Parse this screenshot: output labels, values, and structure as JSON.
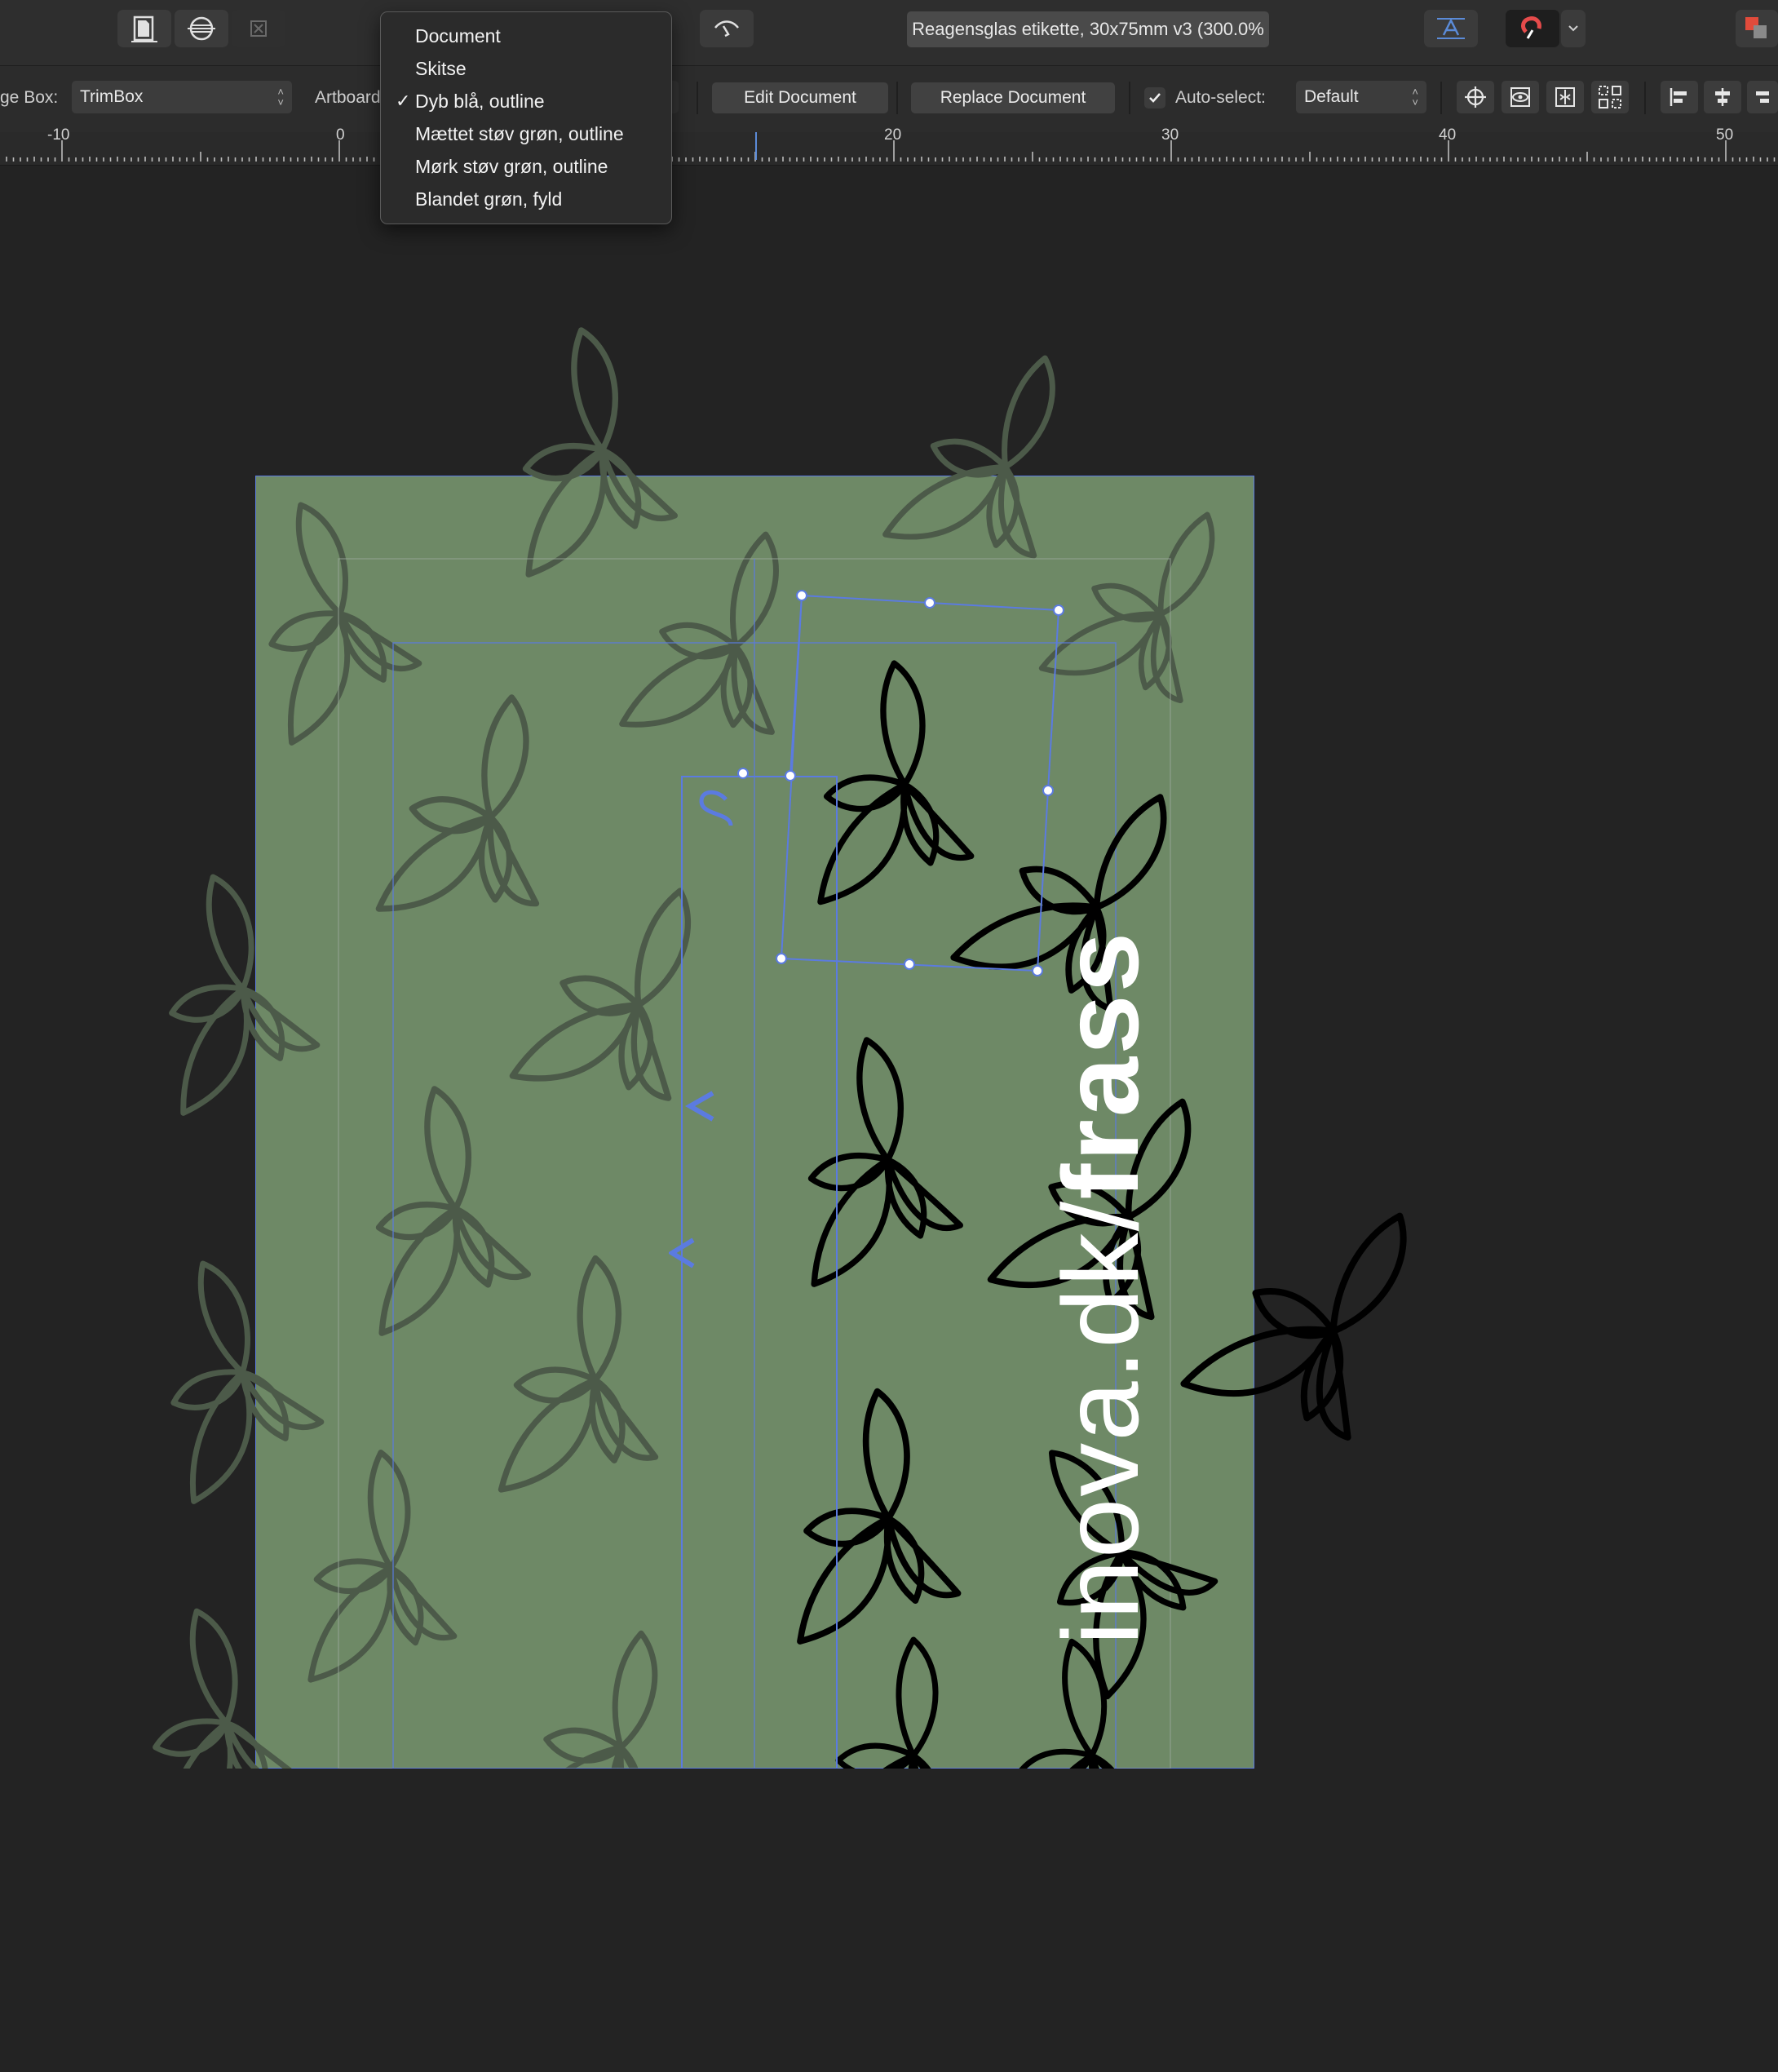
{
  "toolbar": {
    "document_title": "Reagensglas etikette, 30x75mm v3 (300.0%"
  },
  "context_bar": {
    "page_box_label": "ge Box:",
    "page_box_value": "TrimBox",
    "artboard_label": "Artboard",
    "edit_document": "Edit Document",
    "replace_document": "Replace Document",
    "auto_select_label": "Auto-select:",
    "auto_select_checked": true,
    "auto_select_value": "Default"
  },
  "artboard_menu": {
    "items": [
      {
        "label": "Document",
        "checked": false
      },
      {
        "label": "Skitse",
        "checked": false
      },
      {
        "label": "Dyb blå, outline",
        "checked": true
      },
      {
        "label": "Mættet støv grøn, outline",
        "checked": false
      },
      {
        "label": "Mørk støv grøn, outline",
        "checked": false
      },
      {
        "label": "Blandet grøn, fyld",
        "checked": false
      }
    ]
  },
  "ruler": {
    "labels": [
      "-10",
      "0",
      "20",
      "30",
      "40",
      "50"
    ]
  },
  "canvas": {
    "label_text_plain": "inova.dk/",
    "label_text_bold": "frass",
    "artboard_color": "#6e8966",
    "selection_color": "#5b7be0",
    "leaf_fill_faint": "#4c5a49",
    "leaf_stroke_dark": "#000000"
  },
  "icons": {
    "toolbar": [
      "place-image-icon",
      "pixel-persona-icon",
      "export-persona-icon",
      "view-mode-icon",
      "text-style-icon",
      "snapping-magnet-icon",
      "chevron-down-icon",
      "color-swatch-icon"
    ],
    "context": [
      "auto-select-checkbox",
      "transform-origin-icon",
      "visibility-icon",
      "distribute-icon",
      "grid-align-icon",
      "align-left-icon",
      "align-center-icon",
      "align-right-icon"
    ]
  }
}
